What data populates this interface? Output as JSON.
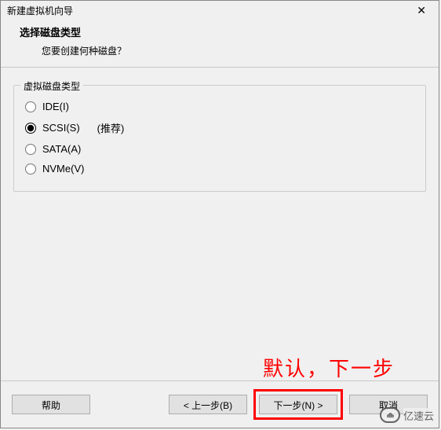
{
  "window": {
    "title": "新建虚拟机向导",
    "close_icon": "✕"
  },
  "header": {
    "title": "选择磁盘类型",
    "subtitle": "您要创建何种磁盘？"
  },
  "group": {
    "legend": "虚拟磁盘类型",
    "options": [
      {
        "label": "IDE(I)",
        "selected": false
      },
      {
        "label": "SCSI(S)",
        "selected": true,
        "extra": "(推荐)"
      },
      {
        "label": "SATA(A)",
        "selected": false
      },
      {
        "label": "NVMe(V)",
        "selected": false
      }
    ]
  },
  "annotation": "默认，下一步",
  "buttons": {
    "help": "帮助",
    "back": "< 上一步(B)",
    "next": "下一步(N) >",
    "cancel": "取消"
  },
  "watermark": {
    "icon": "ക",
    "text": "亿速云"
  }
}
